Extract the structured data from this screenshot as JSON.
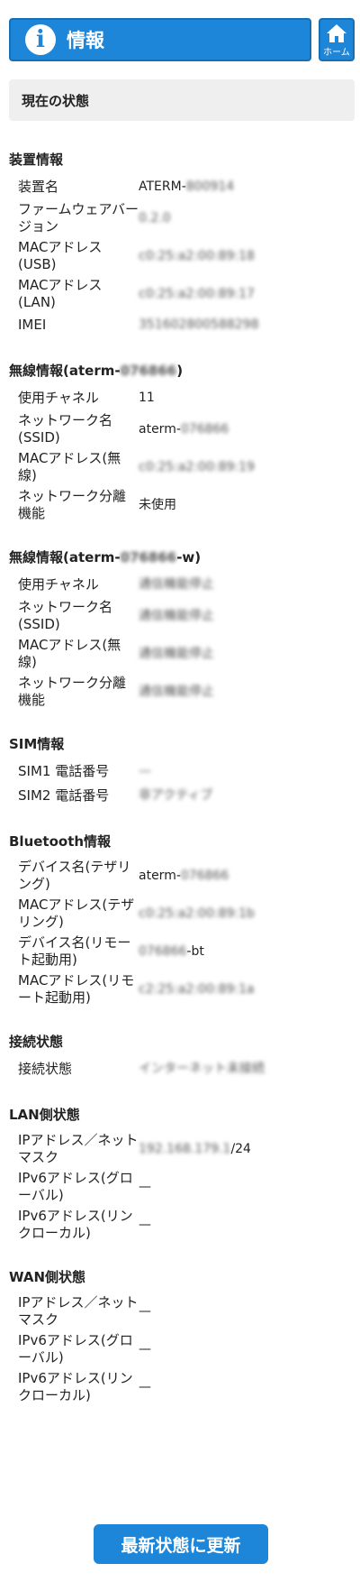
{
  "header": {
    "title": "情報",
    "icon": "info-icon"
  },
  "home": {
    "label": "ホーム",
    "icon": "home-icon"
  },
  "status_title": "現在の状態",
  "sections": [
    {
      "title": "装置情報",
      "rows": [
        {
          "label": "装置名",
          "value": "ATERM-",
          "blur": "800914"
        },
        {
          "label": "ファームウェアバージョン",
          "value": "",
          "blur": "0.2.0"
        },
        {
          "label": "MACアドレス(USB)",
          "value": "",
          "blur": "c0:25:a2:00:89:18"
        },
        {
          "label": "MACアドレス(LAN)",
          "value": "",
          "blur": "c0:25:a2:00:89:17"
        },
        {
          "label": "IMEI",
          "value": "",
          "blur": "351602800588298"
        }
      ]
    },
    {
      "title": "無線情報(aterm-",
      "title_blur": "076866",
      "title_suffix": ")",
      "rows": [
        {
          "label": "使用チャネル",
          "value": "11",
          "blur": ""
        },
        {
          "label": "ネットワーク名(SSID)",
          "value": "aterm-",
          "blur": "076866"
        },
        {
          "label": "MACアドレス(無線)",
          "value": "",
          "blur": "c0:25:a2:00:89:19"
        },
        {
          "label": "ネットワーク分離機能",
          "value": "未使用",
          "blur": ""
        }
      ]
    },
    {
      "title": "無線情報(aterm-",
      "title_blur": "076866",
      "title_suffix": "-w)",
      "rows": [
        {
          "label": "使用チャネル",
          "value": "",
          "blur": "通信機能停止"
        },
        {
          "label": "ネットワーク名(SSID)",
          "value": "",
          "blur": "通信機能停止"
        },
        {
          "label": "MACアドレス(無線)",
          "value": "",
          "blur": "通信機能停止"
        },
        {
          "label": "ネットワーク分離機能",
          "value": "",
          "blur": "通信機能停止"
        }
      ]
    },
    {
      "title": "SIM情報",
      "rows": [
        {
          "label": "SIM1 電話番号",
          "value": "",
          "blur": "—"
        },
        {
          "label": "SIM2 電話番号",
          "value": "",
          "blur": "非アクティブ"
        }
      ]
    },
    {
      "title": "Bluetooth情報",
      "rows": [
        {
          "label": "デバイス名(テザリング)",
          "value": "aterm-",
          "blur": "076866"
        },
        {
          "label": "MACアドレス(テザリング)",
          "value": "",
          "blur": "c0:25:a2:00:89:1b"
        },
        {
          "label": "デバイス名(リモート起動用)",
          "value": "-bt",
          "blur": "076866",
          "blur_first": true
        },
        {
          "label": "MACアドレス(リモート起動用)",
          "value": "",
          "blur": "c2:25:a2:00:89:1a"
        }
      ]
    },
    {
      "title": "接続状態",
      "rows": [
        {
          "label": "接続状態",
          "value": "",
          "blur": "インターネット未接続"
        }
      ]
    },
    {
      "title": "LAN側状態",
      "rows": [
        {
          "label": "IPアドレス／ネットマスク",
          "value": "/24",
          "blur": "192.168.179.1",
          "blur_first": true
        },
        {
          "label": "IPv6アドレス(グローバル)",
          "value": "—",
          "blur": ""
        },
        {
          "label": "IPv6アドレス(リンクローカル)",
          "value": "—",
          "blur": ""
        }
      ]
    },
    {
      "title": "WAN側状態",
      "rows": [
        {
          "label": "IPアドレス／ネットマスク",
          "value": "—",
          "blur": ""
        },
        {
          "label": "IPv6アドレス(グローバル)",
          "value": "—",
          "blur": ""
        },
        {
          "label": "IPv6アドレス(リンクローカル)",
          "value": "—",
          "blur": ""
        }
      ]
    }
  ],
  "refresh_label": "最新状態に更新"
}
